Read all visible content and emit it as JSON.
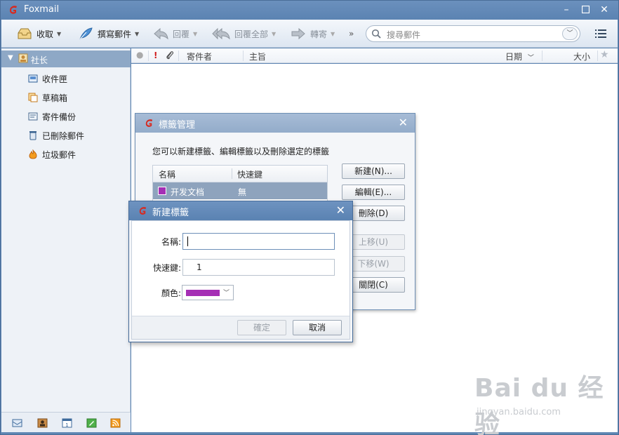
{
  "window": {
    "title": "Foxmail",
    "accent": "#5f86b3",
    "logo_color": "#d72a20"
  },
  "toolbar": {
    "receive": "收取",
    "compose": "撰寫郵件",
    "reply": "回覆",
    "reply_all": "回覆全部",
    "forward": "轉寄",
    "more": "»",
    "search_placeholder": "搜尋郵件"
  },
  "sidebar": {
    "account": "社长",
    "folders": [
      {
        "label": "收件匣",
        "icon": "inbox-icon"
      },
      {
        "label": "草稿箱",
        "icon": "drafts-icon"
      },
      {
        "label": "寄件備份",
        "icon": "sent-icon"
      },
      {
        "label": "已刪除郵件",
        "icon": "trash-icon"
      },
      {
        "label": "垃圾郵件",
        "icon": "junk-icon"
      }
    ],
    "bottom_icons": [
      "mail-icon",
      "contacts-icon",
      "calendar-icon",
      "notes-icon",
      "rss-icon"
    ]
  },
  "list_header": {
    "important": "!",
    "sender": "寄件者",
    "subject": "主旨",
    "date": "日期",
    "size": "大小"
  },
  "tag_manager": {
    "title": "標籤管理",
    "description": "您可以新建標籤、編輯標籤以及刪除選定的標籤",
    "col_name": "名稱",
    "col_shortcut": "快速鍵",
    "rows": [
      {
        "name": "开发文档",
        "shortcut": "無",
        "color": "#a52fb5"
      }
    ],
    "btn_new": "新建(N)...",
    "btn_edit": "編輯(E)...",
    "btn_delete": "刪除(D)",
    "btn_up": "上移(U)",
    "btn_down": "下移(W)",
    "btn_close": "關閉(C)"
  },
  "new_tag": {
    "title": "新建標籤",
    "name_label": "名稱:",
    "name_value": "",
    "shortcut_label": "快速鍵:",
    "shortcut_value": "1",
    "color_label": "顏色:",
    "color_value": "#a52fb5",
    "ok": "確定",
    "cancel": "取消"
  },
  "watermark": {
    "line1": "Bai du 经验",
    "line2": "jingyan.baidu.com"
  }
}
